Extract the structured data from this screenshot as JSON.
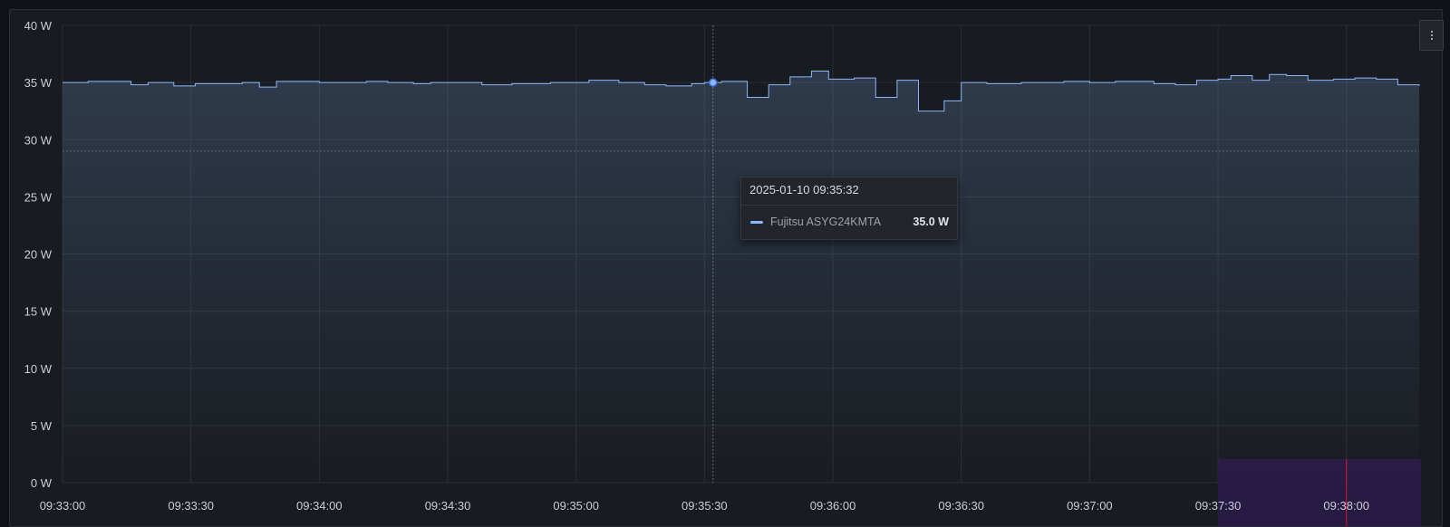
{
  "panel": {
    "menu_icon": "kebab-menu-icon"
  },
  "tooltip": {
    "time": "2025-01-10 09:35:32",
    "series": "Fujitsu ASYG24KMTA",
    "value": "35.0 W",
    "color": "#8ab8ff"
  },
  "colors": {
    "background": "#111217",
    "panel": "#181b1f",
    "grid": "#2a2d33",
    "axis_text": "#ccccdc",
    "series": "#8ab8ff",
    "annotation_region": "#2a1a4a",
    "annotation_line": "#c4162a"
  },
  "chart_data": {
    "type": "line",
    "style": "step-after with gradient area fill",
    "x_start": "09:33:00",
    "x_end": "09:38:17",
    "xlim_seconds_labels": [
      "09:33:00",
      "09:38:17"
    ],
    "xticks": [
      "09:33:00",
      "09:33:30",
      "09:34:00",
      "09:34:30",
      "09:35:00",
      "09:35:30",
      "09:36:00",
      "09:36:30",
      "09:37:00",
      "09:37:30",
      "09:38:00"
    ],
    "yticks": [
      "0 W",
      "5 W",
      "10 W",
      "15 W",
      "20 W",
      "25 W",
      "30 W",
      "35 W",
      "40 W"
    ],
    "ylim": [
      0,
      40
    ],
    "unit": "W",
    "grid": true,
    "legend": "none",
    "series": [
      {
        "name": "Fujitsu ASYG24KMTA",
        "color": "#8ab8ff",
        "x": [
          "09:33:00",
          "09:33:06",
          "09:33:16",
          "09:33:20",
          "09:33:26",
          "09:33:31",
          "09:33:42",
          "09:33:46",
          "09:33:50",
          "09:34:00",
          "09:34:11",
          "09:34:16",
          "09:34:22",
          "09:34:26",
          "09:34:32",
          "09:34:38",
          "09:34:45",
          "09:34:54",
          "09:35:00",
          "09:35:03",
          "09:35:10",
          "09:35:16",
          "09:35:21",
          "09:35:27",
          "09:35:30",
          "09:35:34",
          "09:35:40",
          "09:35:45",
          "09:35:50",
          "09:35:55",
          "09:35:59",
          "09:36:05",
          "09:36:10",
          "09:36:15",
          "09:36:20",
          "09:36:26",
          "09:36:30",
          "09:36:36",
          "09:36:44",
          "09:36:54",
          "09:37:00",
          "09:37:06",
          "09:37:10",
          "09:37:15",
          "09:37:20",
          "09:37:25",
          "09:37:30",
          "09:37:33",
          "09:37:38",
          "09:37:42",
          "09:37:46",
          "09:37:51",
          "09:37:57",
          "09:38:02",
          "09:38:07",
          "09:38:12",
          "09:38:17"
        ],
        "y": [
          35.0,
          35.1,
          34.8,
          35.0,
          34.7,
          34.9,
          35.0,
          34.6,
          35.1,
          35.0,
          35.1,
          35.0,
          34.9,
          35.0,
          35.0,
          34.8,
          34.9,
          35.0,
          35.0,
          35.2,
          35.0,
          34.8,
          34.7,
          34.9,
          35.0,
          35.1,
          33.7,
          34.8,
          35.5,
          36.0,
          35.3,
          35.4,
          33.7,
          35.2,
          32.5,
          33.4,
          35.0,
          34.9,
          35.0,
          35.1,
          35.0,
          35.1,
          35.1,
          34.9,
          34.8,
          35.2,
          35.3,
          35.6,
          35.2,
          35.7,
          35.6,
          35.2,
          35.3,
          35.4,
          35.3,
          34.8,
          34.7
        ]
      }
    ],
    "hover": {
      "time": "09:35:32",
      "value": 35.0
    },
    "crosshair_y_value": 29.0,
    "annotation": {
      "region": [
        "09:37:30",
        "09:38:17"
      ],
      "line": "09:38:00"
    }
  }
}
